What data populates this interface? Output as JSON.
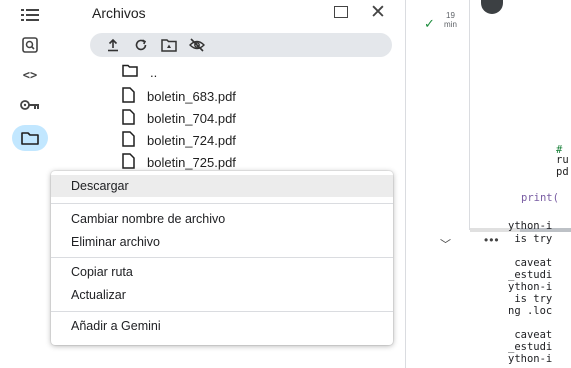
{
  "rail": {
    "items": [
      {
        "icon": "list-icon"
      },
      {
        "icon": "search-icon"
      },
      {
        "icon": "code-icon",
        "label": "<>"
      },
      {
        "icon": "key-icon"
      },
      {
        "icon": "folder-icon",
        "active": true
      }
    ]
  },
  "files_panel": {
    "title": "Archivos",
    "toolbar": [
      "upload-icon",
      "refresh-icon",
      "drive-folder-icon",
      "hide-icon"
    ],
    "items": [
      {
        "name": "..",
        "type": "folder"
      },
      {
        "name": "boletin_683.pdf",
        "type": "file"
      },
      {
        "name": "boletin_704.pdf",
        "type": "file"
      },
      {
        "name": "boletin_724.pdf",
        "type": "file"
      },
      {
        "name": "boletin_725.pdf",
        "type": "file"
      }
    ]
  },
  "context_menu": {
    "download": "Descargar",
    "rename": "Cambiar nombre de archivo",
    "delete": "Eliminar archivo",
    "copy_path": "Copiar ruta",
    "refresh": "Actualizar",
    "add_gemini": "Añadir a Gemini"
  },
  "cell": {
    "exec_time_value": "19",
    "exec_time_unit": "min",
    "code_lines": [
      "#",
      "ru",
      "pd"
    ],
    "print_text": "print(",
    "output_lines": [
      "ython-i",
      " is try",
      "",
      " caveat",
      "_estudi",
      "ython-i",
      " is try",
      "ng .loc",
      "",
      " caveat",
      "_estudi",
      "ython-i"
    ]
  },
  "colors": {
    "active_rail": "#c2e7ff",
    "toolbar_bg": "#e4e7eb",
    "check": "#1e8e3e",
    "comment": "#188038",
    "print": "#795da3"
  }
}
